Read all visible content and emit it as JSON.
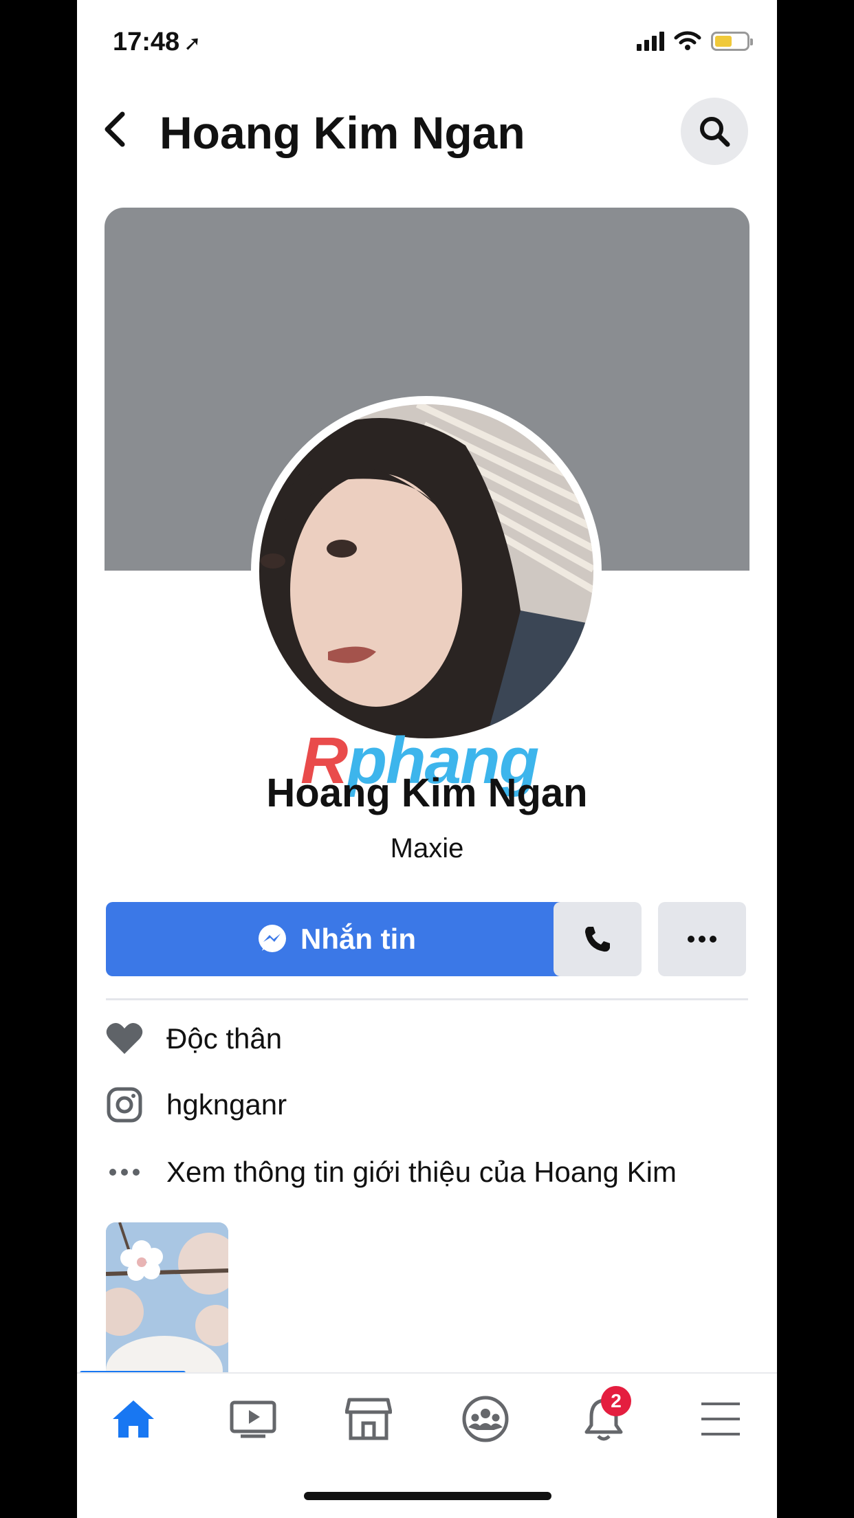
{
  "status": {
    "time": "17:48",
    "battery_level": 0.55
  },
  "header": {
    "title": "Hoang Kim Ngan"
  },
  "profile": {
    "name": "Hoang Kim Ngan",
    "subtitle": "Maxie"
  },
  "watermark": {
    "text_r": "R",
    "text_rest": "phang"
  },
  "actions": {
    "message_label": "Nhắn tin"
  },
  "info": [
    {
      "icon": "heart-icon",
      "text": "Độc thân"
    },
    {
      "icon": "instagram-icon",
      "text": "hgknganr"
    },
    {
      "icon": "more-dots-icon",
      "text": "Xem thông tin giới thiệu của Hoang Kim"
    }
  ],
  "nav": {
    "items": [
      "home-icon",
      "watch-icon",
      "marketplace-icon",
      "groups-icon",
      "notifications-icon",
      "menu-icon"
    ],
    "notifications_badge": "2"
  },
  "colors": {
    "primary": "#3b78e7",
    "active_nav": "#1877f2",
    "cover": "#8a8d91",
    "badge": "#e41e3f"
  }
}
